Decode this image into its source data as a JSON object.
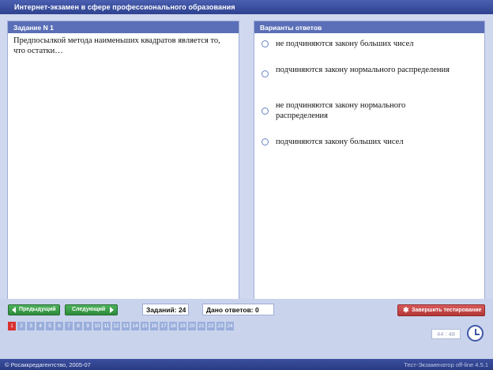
{
  "window": {
    "title": "Интернет-экзамен в сфере профессионального образования"
  },
  "question_panel": {
    "header": "Задание N 1",
    "text": "Предпосылкой метода наименьших квадратов является то, что остатки…"
  },
  "answers_panel": {
    "header": "Варианты ответов",
    "options": [
      "не подчиняются закону больших чисел",
      "подчиняются закону нормального распределения",
      "не подчиняются закону нормального распределения",
      "подчиняются закону больших чисел"
    ]
  },
  "navigation": {
    "prev_label": "Предыдущий",
    "next_label": "Следующий",
    "tasks_label": "Заданий: 24",
    "answered_label": "Дано ответов: 0",
    "finish_label": "Завершить тестирование",
    "question_numbers": [
      "1",
      "2",
      "3",
      "4",
      "5",
      "6",
      "7",
      "8",
      "9",
      "10",
      "11",
      "12",
      "13",
      "14",
      "15",
      "16",
      "17",
      "18",
      "19",
      "20",
      "21",
      "22",
      "23",
      "24"
    ],
    "active_question": "1"
  },
  "timer": {
    "value": "44 : 48"
  },
  "footer": {
    "left": "© Росаккредагентство, 2005-07",
    "right": "Тест-Экзаменатор off-line 4.5.1"
  },
  "colors": {
    "accent": "#5a6fb7",
    "nav_green": "#3a9c48",
    "finish_red": "#c24444",
    "active_cell": "#d9302e"
  },
  "icons": [
    "arrow-left-icon",
    "arrow-right-icon",
    "runner-icon",
    "clock-icon",
    "radio-icon"
  ]
}
